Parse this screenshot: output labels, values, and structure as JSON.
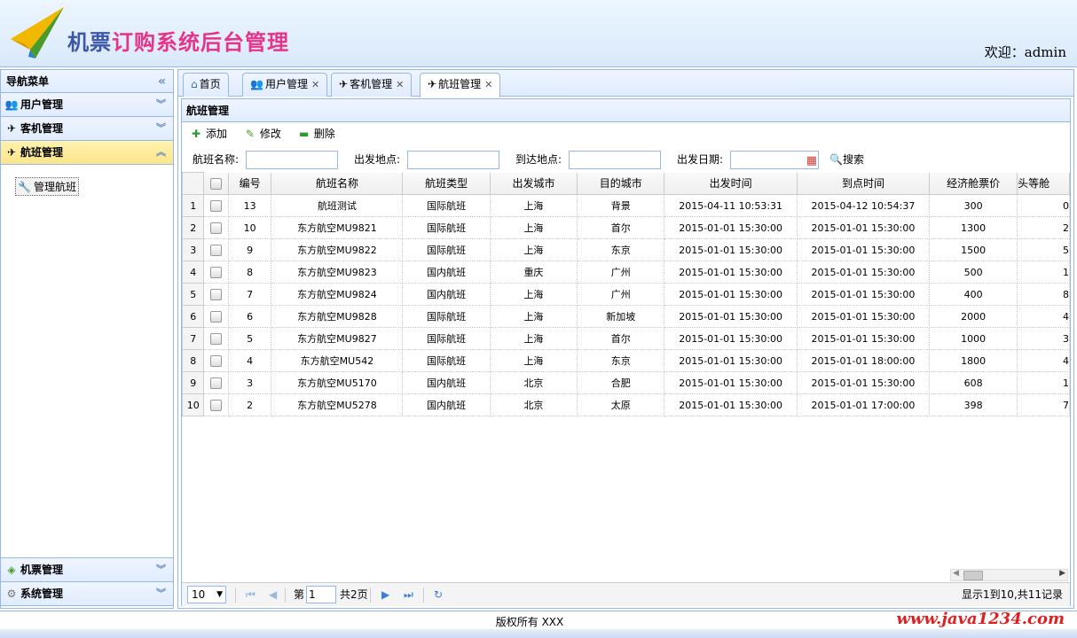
{
  "header": {
    "title_part1": "机票",
    "title_part2": "订购系统后台管理",
    "welcome": "欢迎：admin"
  },
  "sidebar": {
    "title": "导航菜单",
    "collapse_glyph": "«",
    "sections": [
      {
        "label": "用户管理",
        "icon": "users-icon"
      },
      {
        "label": "客机管理",
        "icon": "plane-icon"
      },
      {
        "label": "航班管理",
        "icon": "flight-icon",
        "active": true
      }
    ],
    "active_items": [
      {
        "label": "管理航班",
        "icon": "tools-icon"
      }
    ],
    "bottom_sections": [
      {
        "label": "机票管理",
        "icon": "ticket-icon"
      },
      {
        "label": "系统管理",
        "icon": "gear-icon"
      }
    ]
  },
  "tabs": [
    {
      "label": "首页",
      "icon": "home-icon",
      "closable": false
    },
    {
      "label": "用户管理",
      "icon": "users-icon",
      "closable": true
    },
    {
      "label": "客机管理",
      "icon": "plane-icon",
      "closable": true
    },
    {
      "label": "航班管理",
      "icon": "flight-icon",
      "closable": true,
      "selected": true
    }
  ],
  "panel": {
    "title": "航班管理",
    "toolbar": {
      "add": "添加",
      "edit": "修改",
      "delete": "删除"
    },
    "search": {
      "name_label": "航班名称:",
      "from_label": "出发地点:",
      "to_label": "到达地点:",
      "date_label": "出发日期:",
      "search_button": "搜索"
    }
  },
  "grid": {
    "columns": [
      "编号",
      "航班名称",
      "航班类型",
      "出发城市",
      "目的城市",
      "出发时间",
      "到点时间",
      "经济舱票价",
      "头等舱"
    ],
    "rows": [
      [
        "1",
        "13",
        "航班测试",
        "国际航班",
        "上海",
        "背景",
        "2015-04-11 10:53:31",
        "2015-04-12 10:54:37",
        "300",
        "0"
      ],
      [
        "2",
        "10",
        "东方航空MU9821",
        "国际航班",
        "上海",
        "首尔",
        "2015-01-01 15:30:00",
        "2015-01-01 15:30:00",
        "1300",
        "2"
      ],
      [
        "3",
        "9",
        "东方航空MU9822",
        "国际航班",
        "上海",
        "东京",
        "2015-01-01 15:30:00",
        "2015-01-01 15:30:00",
        "1500",
        "5"
      ],
      [
        "4",
        "8",
        "东方航空MU9823",
        "国内航班",
        "重庆",
        "广州",
        "2015-01-01 15:30:00",
        "2015-01-01 15:30:00",
        "500",
        "1"
      ],
      [
        "5",
        "7",
        "东方航空MU9824",
        "国内航班",
        "上海",
        "广州",
        "2015-01-01 15:30:00",
        "2015-01-01 15:30:00",
        "400",
        "8"
      ],
      [
        "6",
        "6",
        "东方航空MU9828",
        "国际航班",
        "上海",
        "新加坡",
        "2015-01-01 15:30:00",
        "2015-01-01 15:30:00",
        "2000",
        "4"
      ],
      [
        "7",
        "5",
        "东方航空MU9827",
        "国际航班",
        "上海",
        "首尔",
        "2015-01-01 15:30:00",
        "2015-01-01 15:30:00",
        "1000",
        "3"
      ],
      [
        "8",
        "4",
        "东方航空MU542",
        "国际航班",
        "上海",
        "东京",
        "2015-01-01 15:30:00",
        "2015-01-01 18:00:00",
        "1800",
        "4"
      ],
      [
        "9",
        "3",
        "东方航空MU5170",
        "国内航班",
        "北京",
        "合肥",
        "2015-01-01 15:30:00",
        "2015-01-01 15:30:00",
        "608",
        "1"
      ],
      [
        "10",
        "2",
        "东方航空MU5278",
        "国内航班",
        "北京",
        "太原",
        "2015-01-01 15:30:00",
        "2015-01-01 17:00:00",
        "398",
        "7"
      ]
    ]
  },
  "pager": {
    "page_size": "10",
    "page_prefix": "第",
    "page_value": "1",
    "page_suffix": "共2页",
    "info": "显示1到10,共11记录"
  },
  "footer": {
    "copyright": "版权所有 XXX",
    "watermark": "www.java1234.com"
  },
  "colors": {
    "border": "#95b8e7",
    "accent_blue": "#3c57a8",
    "accent_pink": "#e8338a",
    "watermark": "#e02020"
  }
}
